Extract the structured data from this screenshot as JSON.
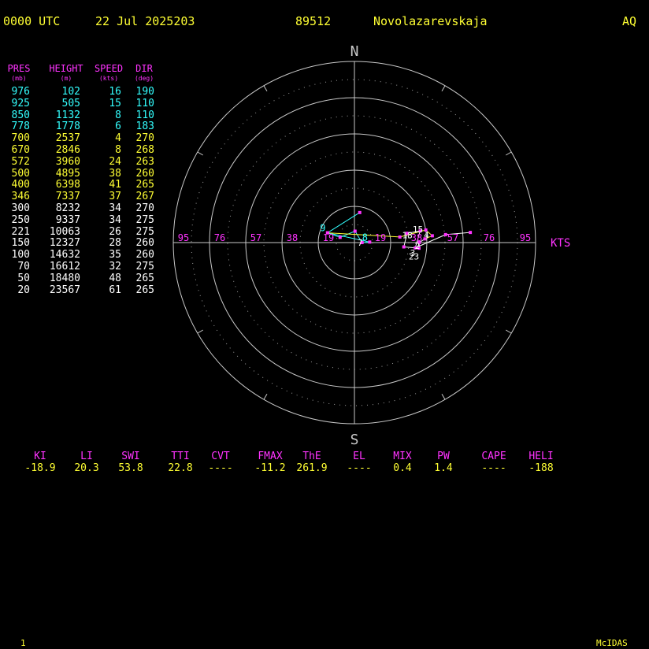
{
  "header": {
    "time": "0000 UTC",
    "date": "22 Jul 2025203",
    "station_id": "89512",
    "station_name": "Novolazarevskaja",
    "region": "AQ"
  },
  "table": {
    "headers": [
      {
        "label": "PRES",
        "unit": "(mb)"
      },
      {
        "label": "HEIGHT",
        "unit": "(m)"
      },
      {
        "label": "SPEED",
        "unit": "(kts)"
      },
      {
        "label": "DIR",
        "unit": "(deg)"
      }
    ],
    "rows": [
      {
        "pres": "976",
        "height": "102",
        "speed": "16",
        "dir": "190",
        "color": "#33ffff"
      },
      {
        "pres": "925",
        "height": "505",
        "speed": "15",
        "dir": "110",
        "color": "#33ffff"
      },
      {
        "pres": "850",
        "height": "1132",
        "speed": "8",
        "dir": "110",
        "color": "#33ffff"
      },
      {
        "pres": "778",
        "height": "1778",
        "speed": "6",
        "dir": "183",
        "color": "#33ffff"
      },
      {
        "pres": "700",
        "height": "2537",
        "speed": "4",
        "dir": "270",
        "color": "#ffff33"
      },
      {
        "pres": "670",
        "height": "2846",
        "speed": "8",
        "dir": "268",
        "color": "#ffff33"
      },
      {
        "pres": "572",
        "height": "3960",
        "speed": "24",
        "dir": "263",
        "color": "#ffff33"
      },
      {
        "pres": "500",
        "height": "4895",
        "speed": "38",
        "dir": "260",
        "color": "#ffff33"
      },
      {
        "pres": "400",
        "height": "6398",
        "speed": "41",
        "dir": "265",
        "color": "#ffff33"
      },
      {
        "pres": "346",
        "height": "7337",
        "speed": "37",
        "dir": "267",
        "color": "#ffff33"
      },
      {
        "pres": "300",
        "height": "8232",
        "speed": "34",
        "dir": "270",
        "color": "#ffffff"
      },
      {
        "pres": "250",
        "height": "9337",
        "speed": "34",
        "dir": "275",
        "color": "#ffffff"
      },
      {
        "pres": "221",
        "height": "10063",
        "speed": "26",
        "dir": "275",
        "color": "#ffffff"
      },
      {
        "pres": "150",
        "height": "12327",
        "speed": "28",
        "dir": "260",
        "color": "#ffffff"
      },
      {
        "pres": "100",
        "height": "14632",
        "speed": "35",
        "dir": "260",
        "color": "#ffffff"
      },
      {
        "pres": "70",
        "height": "16612",
        "speed": "32",
        "dir": "275",
        "color": "#ffffff"
      },
      {
        "pres": "50",
        "height": "18480",
        "speed": "48",
        "dir": "265",
        "color": "#ffffff"
      },
      {
        "pres": "20",
        "height": "23567",
        "speed": "61",
        "dir": "265",
        "color": "#ffffff"
      }
    ]
  },
  "chart_data": {
    "type": "hodograph",
    "compass": {
      "north": "N",
      "south": "S"
    },
    "speed_unit_label": "KTS",
    "ring_labels": [
      "95",
      "76",
      "57",
      "38",
      "19",
      "19",
      "38",
      "57",
      "76",
      "95"
    ],
    "rmax_kts": 95,
    "ring_count": 5,
    "trace": [
      {
        "speed": 16,
        "dir": 190,
        "label": "",
        "color": "#33ffff"
      },
      {
        "speed": 15,
        "dir": 110,
        "label": "",
        "color": "#33ffff"
      },
      {
        "speed": 8,
        "dir": 110,
        "label": "",
        "color": "#33ffff"
      },
      {
        "speed": 6,
        "dir": 183,
        "label": "",
        "color": "#33ffff"
      },
      {
        "speed": 4,
        "dir": 270,
        "label": "",
        "color": "#33ffff"
      },
      {
        "speed": 8,
        "dir": 268,
        "label": "8",
        "color": "#33ffff"
      },
      {
        "speed": 15,
        "dir": 110,
        "label": "9",
        "color": "#33ffff"
      },
      {
        "speed": 24,
        "dir": 263,
        "label": "",
        "color": "#ffff33"
      },
      {
        "speed": 38,
        "dir": 260,
        "label": "",
        "color": "#ffff33"
      },
      {
        "speed": 41,
        "dir": 265,
        "label": "",
        "color": "#ffff33"
      },
      {
        "speed": 37,
        "dir": 267,
        "label": "",
        "color": "#ffff33"
      },
      {
        "speed": 34,
        "dir": 270,
        "label": "",
        "color": "#ffffff"
      },
      {
        "speed": 34,
        "dir": 275,
        "label": "",
        "color": "#ffffff"
      },
      {
        "speed": 26,
        "dir": 275,
        "label": "",
        "color": "#ffffff"
      },
      {
        "speed": 28,
        "dir": 260,
        "label": "",
        "color": "#ffffff"
      },
      {
        "speed": 35,
        "dir": 260,
        "label": "",
        "color": "#ffffff"
      },
      {
        "speed": 32,
        "dir": 275,
        "label": "",
        "color": "#ffffff"
      },
      {
        "speed": 48,
        "dir": 265,
        "label": "",
        "color": "#ffffff"
      },
      {
        "speed": 61,
        "dir": 265,
        "label": "",
        "color": "#ffffff"
      }
    ],
    "height_labels": [
      {
        "text": "7",
        "speed": 3,
        "dir": 270
      },
      {
        "text": "18",
        "speed": 28,
        "dir": 262
      },
      {
        "text": "15",
        "speed": 34,
        "dir": 258
      },
      {
        "text": "4",
        "speed": 38,
        "dir": 264
      },
      {
        "text": "2",
        "speed": 33,
        "dir": 273
      },
      {
        "text": "3",
        "speed": 31,
        "dir": 280
      },
      {
        "text": "23",
        "speed": 32,
        "dir": 283
      }
    ]
  },
  "indices": [
    {
      "label": "KI",
      "value": "-18.9"
    },
    {
      "label": "LI",
      "value": "20.3"
    },
    {
      "label": "SWI",
      "value": "53.8"
    },
    {
      "label": "TTI",
      "value": "22.8"
    },
    {
      "label": "CVT",
      "value": "----"
    },
    {
      "label": "FMAX",
      "value": "-11.2"
    },
    {
      "label": "ThE",
      "value": "261.9"
    },
    {
      "label": "EL",
      "value": "----"
    },
    {
      "label": "MIX",
      "value": "0.4"
    },
    {
      "label": "PW",
      "value": "1.4"
    },
    {
      "label": "CAPE",
      "value": "----"
    },
    {
      "label": "HELI",
      "value": "-188"
    }
  ],
  "footer": {
    "frame": "1",
    "brand": "McIDAS"
  }
}
